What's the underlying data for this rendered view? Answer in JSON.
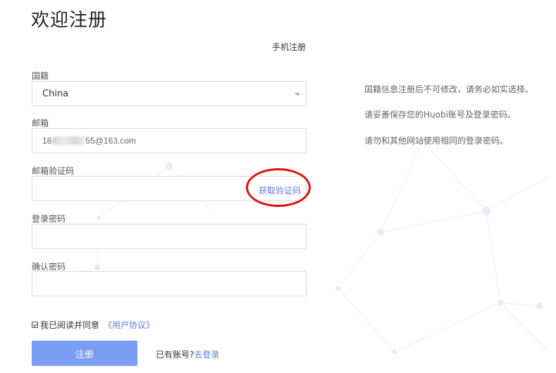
{
  "title": "欢迎注册",
  "tab": "手机注册",
  "fields": {
    "nationality": {
      "label": "国籍",
      "value": "China"
    },
    "email": {
      "label": "邮箱",
      "value_prefix": "18",
      "value_suffix": "55@163.com"
    },
    "email_code": {
      "label": "邮箱验证码",
      "value": "",
      "get_code": "获取验证码"
    },
    "password": {
      "label": "登录密码",
      "value": ""
    },
    "confirm_password": {
      "label": "确认密码",
      "value": ""
    }
  },
  "info": [
    "国籍信息注册后不可修改，请务必如实选择。",
    "请妥善保存您的Huobi账号及登录密码。",
    "请勿和其他网站使用相同的登录密码。"
  ],
  "agreement": {
    "text": "我已阅读并同意",
    "link": "《用户协议》",
    "checked": true
  },
  "register_button": "注册",
  "login_hint": {
    "text": "已有账号?",
    "link": "去登录"
  },
  "colors": {
    "accent": "#5b7fd6",
    "button": "#7b9ef5",
    "annotation": "#e01010"
  }
}
